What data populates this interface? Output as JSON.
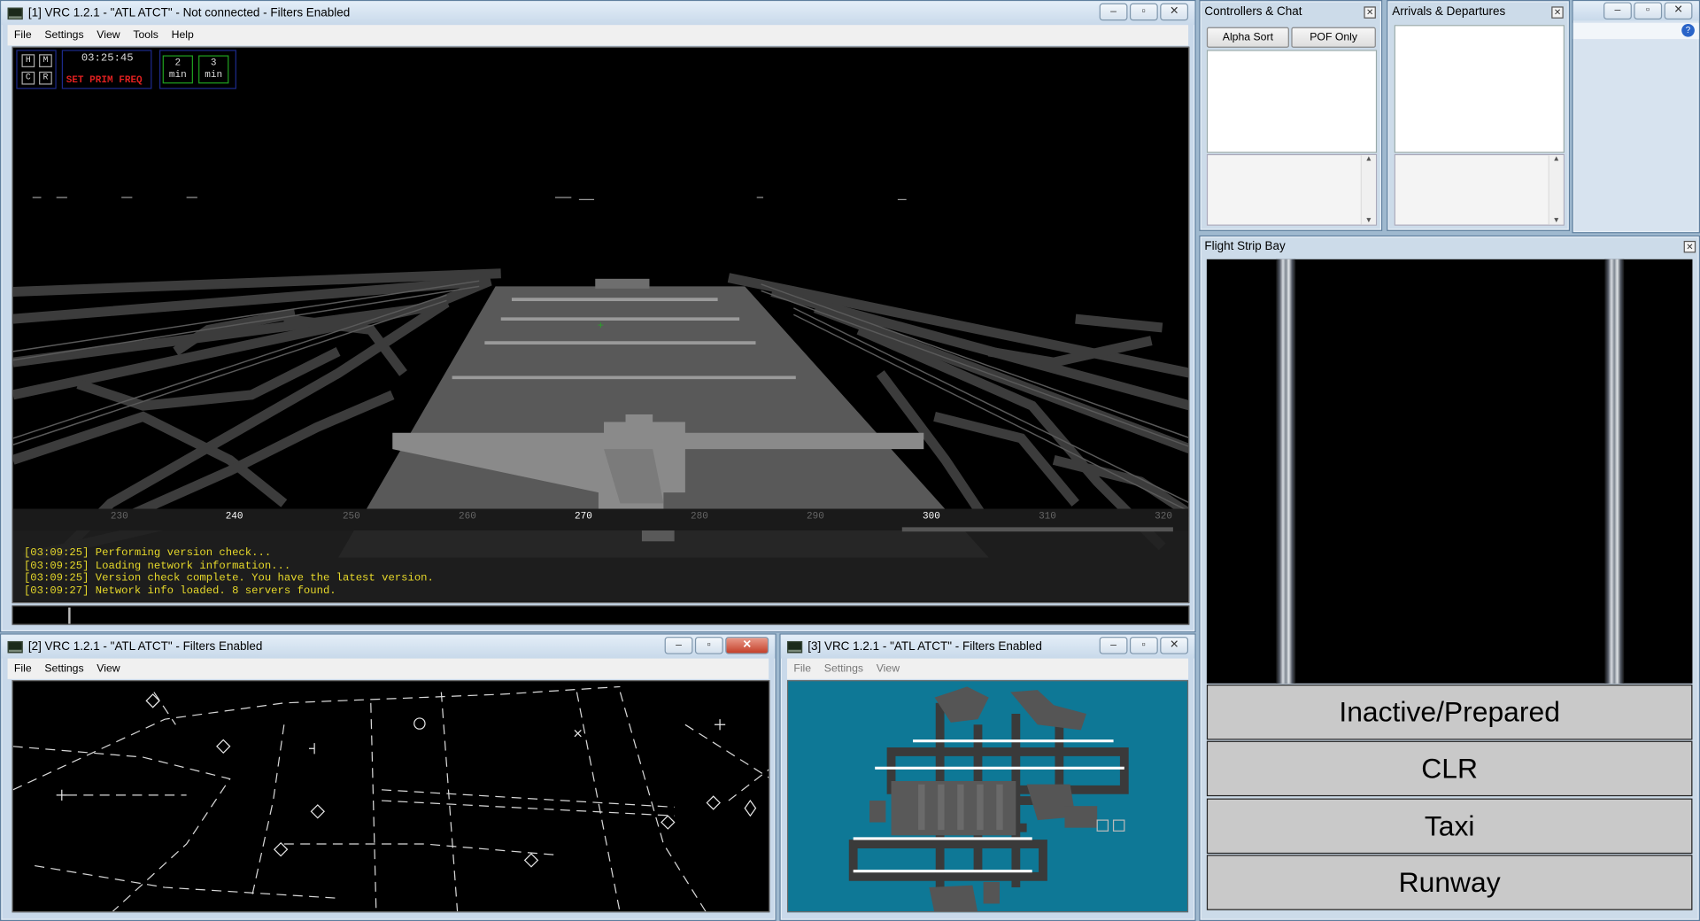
{
  "window1": {
    "title": "[1] VRC 1.2.1 - \"ATL ATCT\" - Not connected - Filters Enabled",
    "menu": [
      "File",
      "Settings",
      "View",
      "Tools",
      "Help"
    ],
    "hud": {
      "keys": [
        "H",
        "M",
        "C",
        "R"
      ],
      "clock": "03:25:45",
      "prim_freq": "SET PRIM FREQ",
      "timers": [
        {
          "n": "2",
          "unit": "min"
        },
        {
          "n": "3",
          "unit": "min"
        }
      ]
    },
    "compass": {
      "ticks": [
        "230",
        "240",
        "250",
        "260",
        "270",
        "280",
        "290",
        "300",
        "310",
        "320"
      ],
      "major": [
        "240",
        "270",
        "300"
      ]
    },
    "log": [
      "[03:09:25] Performing version check...",
      "[03:09:25] Loading network information...",
      "[03:09:25] Version check complete. You have the latest version.",
      "[03:09:27] Network info loaded. 8 servers found."
    ]
  },
  "window2": {
    "title": "[2] VRC 1.2.1 - \"ATL ATCT\" - Filters Enabled",
    "menu": [
      "File",
      "Settings",
      "View"
    ]
  },
  "window3": {
    "title": "[3] VRC 1.2.1 - \"ATL ATCT\" - Filters Enabled",
    "menu": [
      "File",
      "Settings",
      "View"
    ]
  },
  "controllers": {
    "title": "Controllers & Chat",
    "buttons": [
      "Alpha Sort",
      "POF Only"
    ]
  },
  "arrivals": {
    "title": "Arrivals & Departures"
  },
  "strip_bay": {
    "title": "Flight Strip Bay",
    "categories": [
      "Inactive/Prepared",
      "CLR",
      "Taxi",
      "Runway"
    ]
  },
  "colors": {
    "log_text": "#e6d82a",
    "prim_freq": "#e02020",
    "ground_map_bg": "#0e7896"
  }
}
